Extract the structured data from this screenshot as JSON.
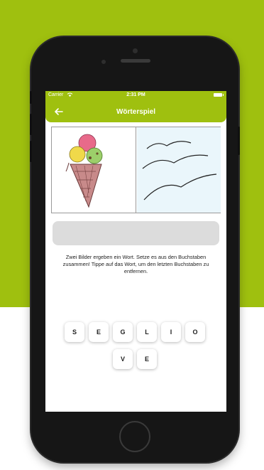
{
  "status_bar": {
    "carrier": "Carrier",
    "time": "2:31 PM"
  },
  "app_bar": {
    "title": "Wörterspiel",
    "back_icon": "arrow-left-icon"
  },
  "pictures": [
    {
      "name": "ice-cream-picture"
    },
    {
      "name": "birds-picture"
    }
  ],
  "answer": {
    "value": ""
  },
  "hint": "Zwei Bilder ergeben ein Wort. Setze es aus den Buchstaben zusammen! Tippe auf das Wort, um den letzten Buchstaben zu entfernen.",
  "letters_row1": [
    "S",
    "E",
    "G",
    "L",
    "I",
    "O"
  ],
  "letters_row2": [
    "V",
    "E"
  ],
  "colors": {
    "accent": "#9fc00f",
    "answer_box": "#dcdcdc"
  }
}
